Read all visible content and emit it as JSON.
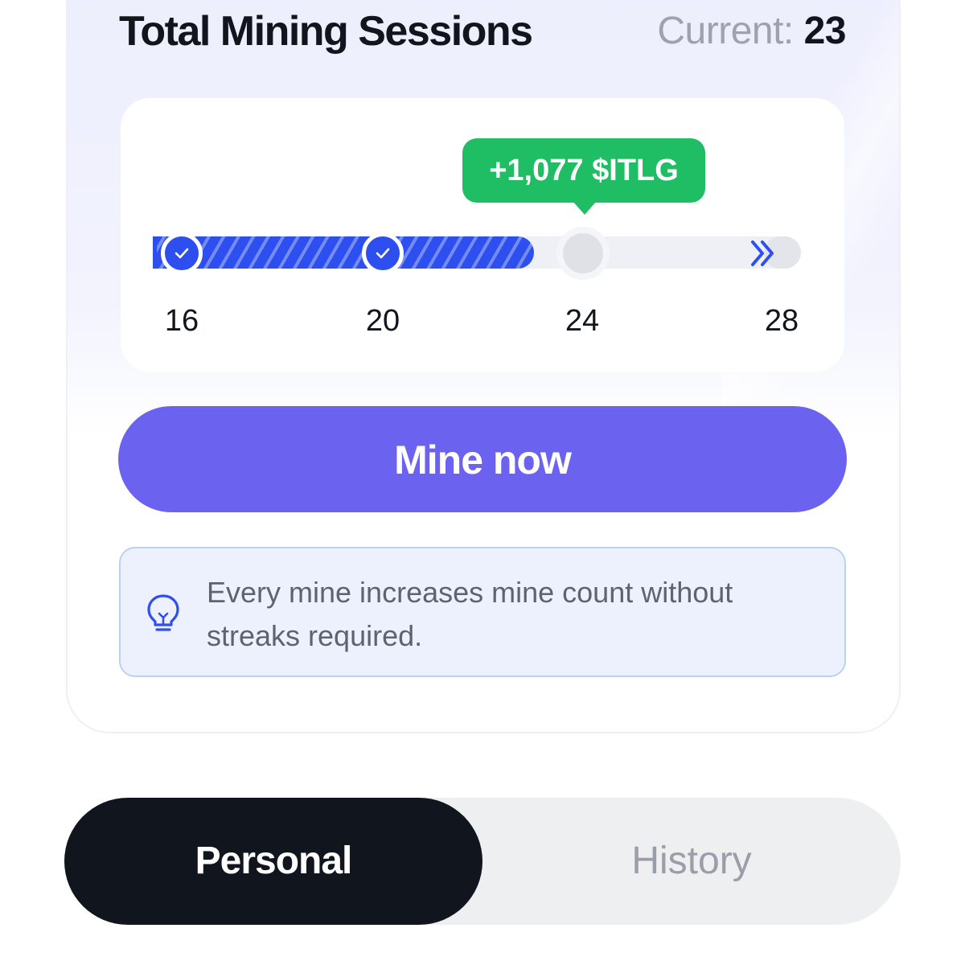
{
  "header": {
    "title": "Total Mining Sessions",
    "current_label": "Current:",
    "current_value": "23"
  },
  "progress": {
    "reward_label": "+1,077 $ITLG",
    "current_sessions": 23,
    "milestones": [
      {
        "label": "16",
        "status": "completed"
      },
      {
        "label": "20",
        "status": "completed"
      },
      {
        "label": "24",
        "status": "next"
      },
      {
        "label": "28",
        "status": "upcoming"
      }
    ],
    "icons": {
      "completed": "check-icon",
      "end": "double-chevron-right-icon"
    },
    "colors": {
      "fill": "#2d4ff0",
      "reward": "#1fbe64",
      "track": "#eef0f5"
    }
  },
  "actions": {
    "mine_label": "Mine now",
    "mine_color": "#6b63f0"
  },
  "hint": {
    "icon": "lightbulb-icon",
    "text_line1": "Every mine increases mine count without",
    "text_line2": "streaks required."
  },
  "tabs": [
    {
      "label": "Personal",
      "active": true
    },
    {
      "label": "History",
      "active": false
    }
  ]
}
